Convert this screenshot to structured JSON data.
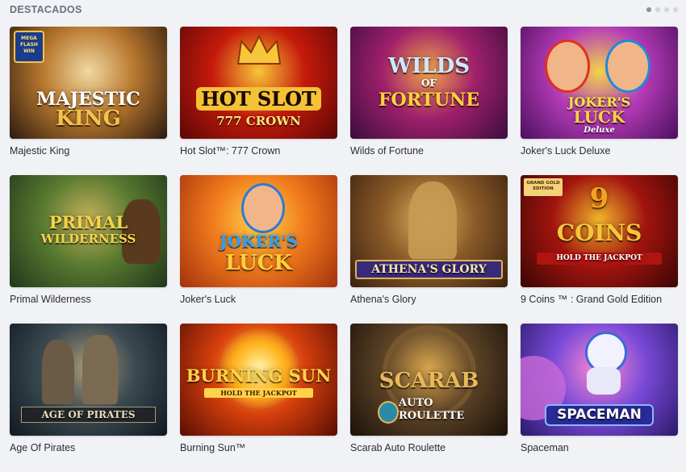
{
  "section": {
    "title": "DESTACADOS",
    "pager": {
      "pages": 4,
      "current": 1
    }
  },
  "games": [
    {
      "name": "Majestic King",
      "art_text": [
        "MAJESTIC",
        "KING"
      ],
      "badge": "MEGA FLASH WIN",
      "palette": [
        "#2a1a10",
        "#b8772e",
        "#f0d9a0"
      ]
    },
    {
      "name": "Hot Slot™: 777 Crown",
      "art_text": [
        "HOT SLOT",
        "777 CROWN"
      ],
      "palette": [
        "#5a0705",
        "#c51a0b",
        "#f7c63a"
      ]
    },
    {
      "name": "Wilds of Fortune",
      "art_text": [
        "WILDS",
        "OF",
        "FORTUNE"
      ],
      "palette": [
        "#3a0d3d",
        "#a0206b",
        "#f2a54b"
      ]
    },
    {
      "name": "Joker's Luck Deluxe",
      "art_text": [
        "JOKER'S",
        "LUCK",
        "Deluxe"
      ],
      "palette": [
        "#4a0f5a",
        "#b43bb8",
        "#f3d44b"
      ]
    },
    {
      "name": "Primal Wilderness",
      "art_text": [
        "PRIMAL",
        "WILDERNESS"
      ],
      "palette": [
        "#20361a",
        "#587a30",
        "#c7b15a"
      ]
    },
    {
      "name": "Joker's Luck",
      "art_text": [
        "JOKER'S",
        "LUCK"
      ],
      "palette": [
        "#a3300c",
        "#f07a1c",
        "#ffd34a"
      ]
    },
    {
      "name": "Athena's Glory",
      "art_text": [
        "ATHENA'S GLORY"
      ],
      "palette": [
        "#3a2110",
        "#8a5a27",
        "#e0b060"
      ]
    },
    {
      "name": "9 Coins ™ : Grand Gold Edition",
      "art_text": [
        "9",
        "COINS",
        "HOLD THE JACKPOT"
      ],
      "badge": "GRAND GOLD EDITION",
      "palette": [
        "#3a0604",
        "#a2140e",
        "#f0b52a"
      ]
    },
    {
      "name": "Age Of Pirates",
      "art_text": [
        "AGE OF PIRATES"
      ],
      "palette": [
        "#101820",
        "#3b4a52",
        "#a89a78"
      ]
    },
    {
      "name": "Burning Sun™",
      "art_text": [
        "BURNING SUN",
        "HOLD THE JACKPOT"
      ],
      "palette": [
        "#5a0d04",
        "#d6400c",
        "#ffd44a"
      ]
    },
    {
      "name": "Scarab Auto Roulette",
      "art_text": [
        "SCARAB",
        "AUTO",
        "ROULETTE"
      ],
      "palette": [
        "#1a120a",
        "#5c4226",
        "#d8a64e"
      ]
    },
    {
      "name": "Spaceman",
      "art_text": [
        "SPACEMAN"
      ],
      "palette": [
        "#2a1a6a",
        "#7a4ad8",
        "#ff8ad0"
      ]
    }
  ]
}
